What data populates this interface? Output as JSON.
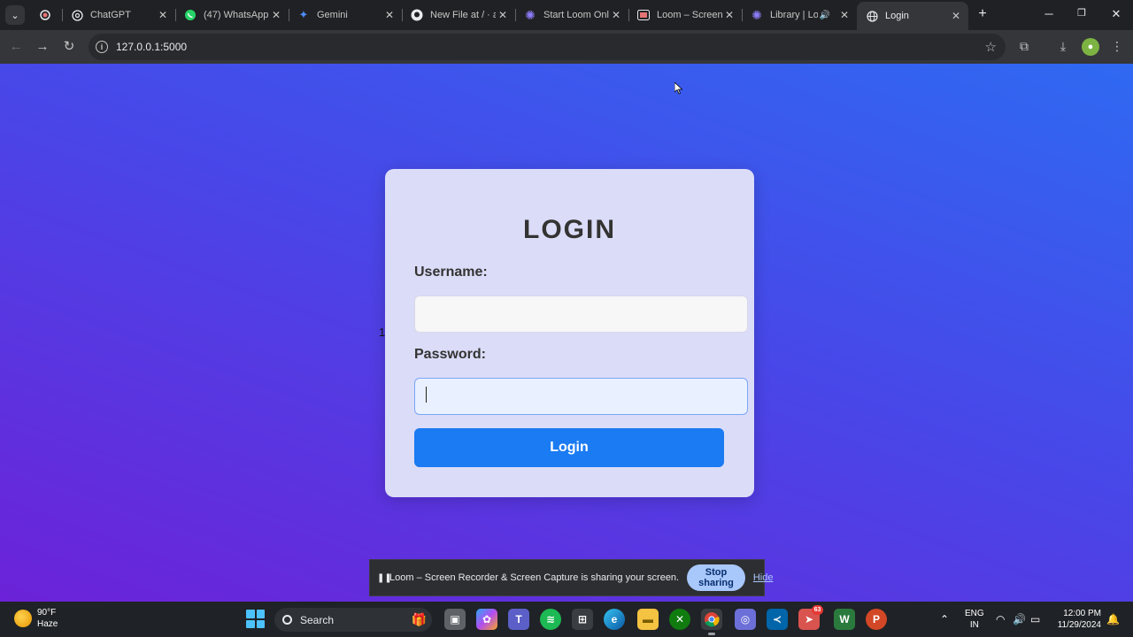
{
  "browser": {
    "tabs": [
      {
        "title": "",
        "icon": "record-icon"
      },
      {
        "title": "ChatGPT",
        "icon": "openai-icon"
      },
      {
        "title": "(47) WhatsApp",
        "icon": "whatsapp-icon"
      },
      {
        "title": "Gemini",
        "icon": "gemini-icon"
      },
      {
        "title": "New File at / · a",
        "icon": "github-icon"
      },
      {
        "title": "Start Loom Onl",
        "icon": "loom-icon"
      },
      {
        "title": "Loom – Screen",
        "icon": "loom-screen-icon"
      },
      {
        "title": "Library | Loo",
        "icon": "loom-icon"
      },
      {
        "title": "Login",
        "icon": "globe-icon"
      }
    ],
    "url": "127.0.0.1:5000"
  },
  "page": {
    "stray_text": "1",
    "title": "LOGIN",
    "username_label": "Username:",
    "username_value": "",
    "password_label": "Password:",
    "password_value": "",
    "login_button": "Login"
  },
  "loom_bar": {
    "message": "Loom – Screen Recorder & Screen Capture is sharing your screen.",
    "stop_label": "Stop sharing",
    "hide_label": "Hide"
  },
  "taskbar": {
    "weather_temp": "90°F",
    "weather_desc": "Haze",
    "search_label": "Search",
    "lang_top": "ENG",
    "lang_bottom": "IN",
    "time": "12:00 PM",
    "date": "11/29/2024",
    "telegram_badge": "63"
  },
  "colors": {
    "accent": "#1a7bf2",
    "bg_top": "#2f69f2",
    "bg_bottom": "#6c22d8"
  }
}
